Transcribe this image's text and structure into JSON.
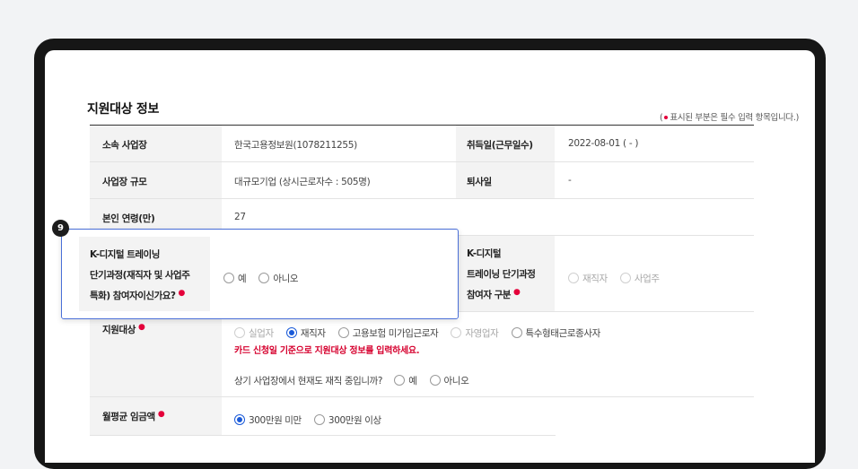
{
  "section": {
    "title": "지원대상 정보",
    "required_note_prefix": "(",
    "required_note_text": "표시된 부분은 필수 입력 항목입니다.)"
  },
  "rows": {
    "workplace": {
      "label": "소속 사업장",
      "value": "한국고용정보원(1078211255)"
    },
    "hire_date": {
      "label": "취득일(근무일수)",
      "value": "2022-08-01 ( - )"
    },
    "scale": {
      "label": "사업장 규모",
      "value": "대규모기업 (상시근로자수 : 505명)"
    },
    "leave_date": {
      "label": "퇴사일",
      "value": "-"
    },
    "age": {
      "label": "본인 연령(만)",
      "value": "27"
    },
    "kdigital": {
      "label_line1": "K-디지털 트레이닝",
      "label_line2": "단기과정(재직자 및 사업주",
      "label_line3": "특화) 참여자이신가요?",
      "options": [
        "예",
        "아니오"
      ]
    },
    "kdigital_type": {
      "label_line1": "K-디지털",
      "label_line2": "트레이닝 단기과정",
      "label_line3": "참여자 구분",
      "options": [
        "재직자",
        "사업주"
      ]
    },
    "target": {
      "label": "지원대상",
      "options": [
        "실업자",
        "재직자",
        "고용보험 미가입근로자",
        "자영업자",
        "특수형태근로종사자"
      ],
      "selected": "재직자",
      "warning": "카드 신청일 기준으로 지원대상 정보를 입력하세요.",
      "question": "상기 사업장에서 현재도 재직 중입니까?",
      "question_options": [
        "예",
        "아니오"
      ]
    },
    "wage": {
      "label": "월평균 임금액",
      "options": [
        "300만원 미만",
        "300만원 이상"
      ],
      "selected": "300만원 미만"
    }
  },
  "callout": {
    "number": "9"
  },
  "colors": {
    "accent": "#1a5ad8",
    "required": "#e4003a",
    "warning": "#d6002e",
    "callout_border": "#4a6fd8"
  }
}
